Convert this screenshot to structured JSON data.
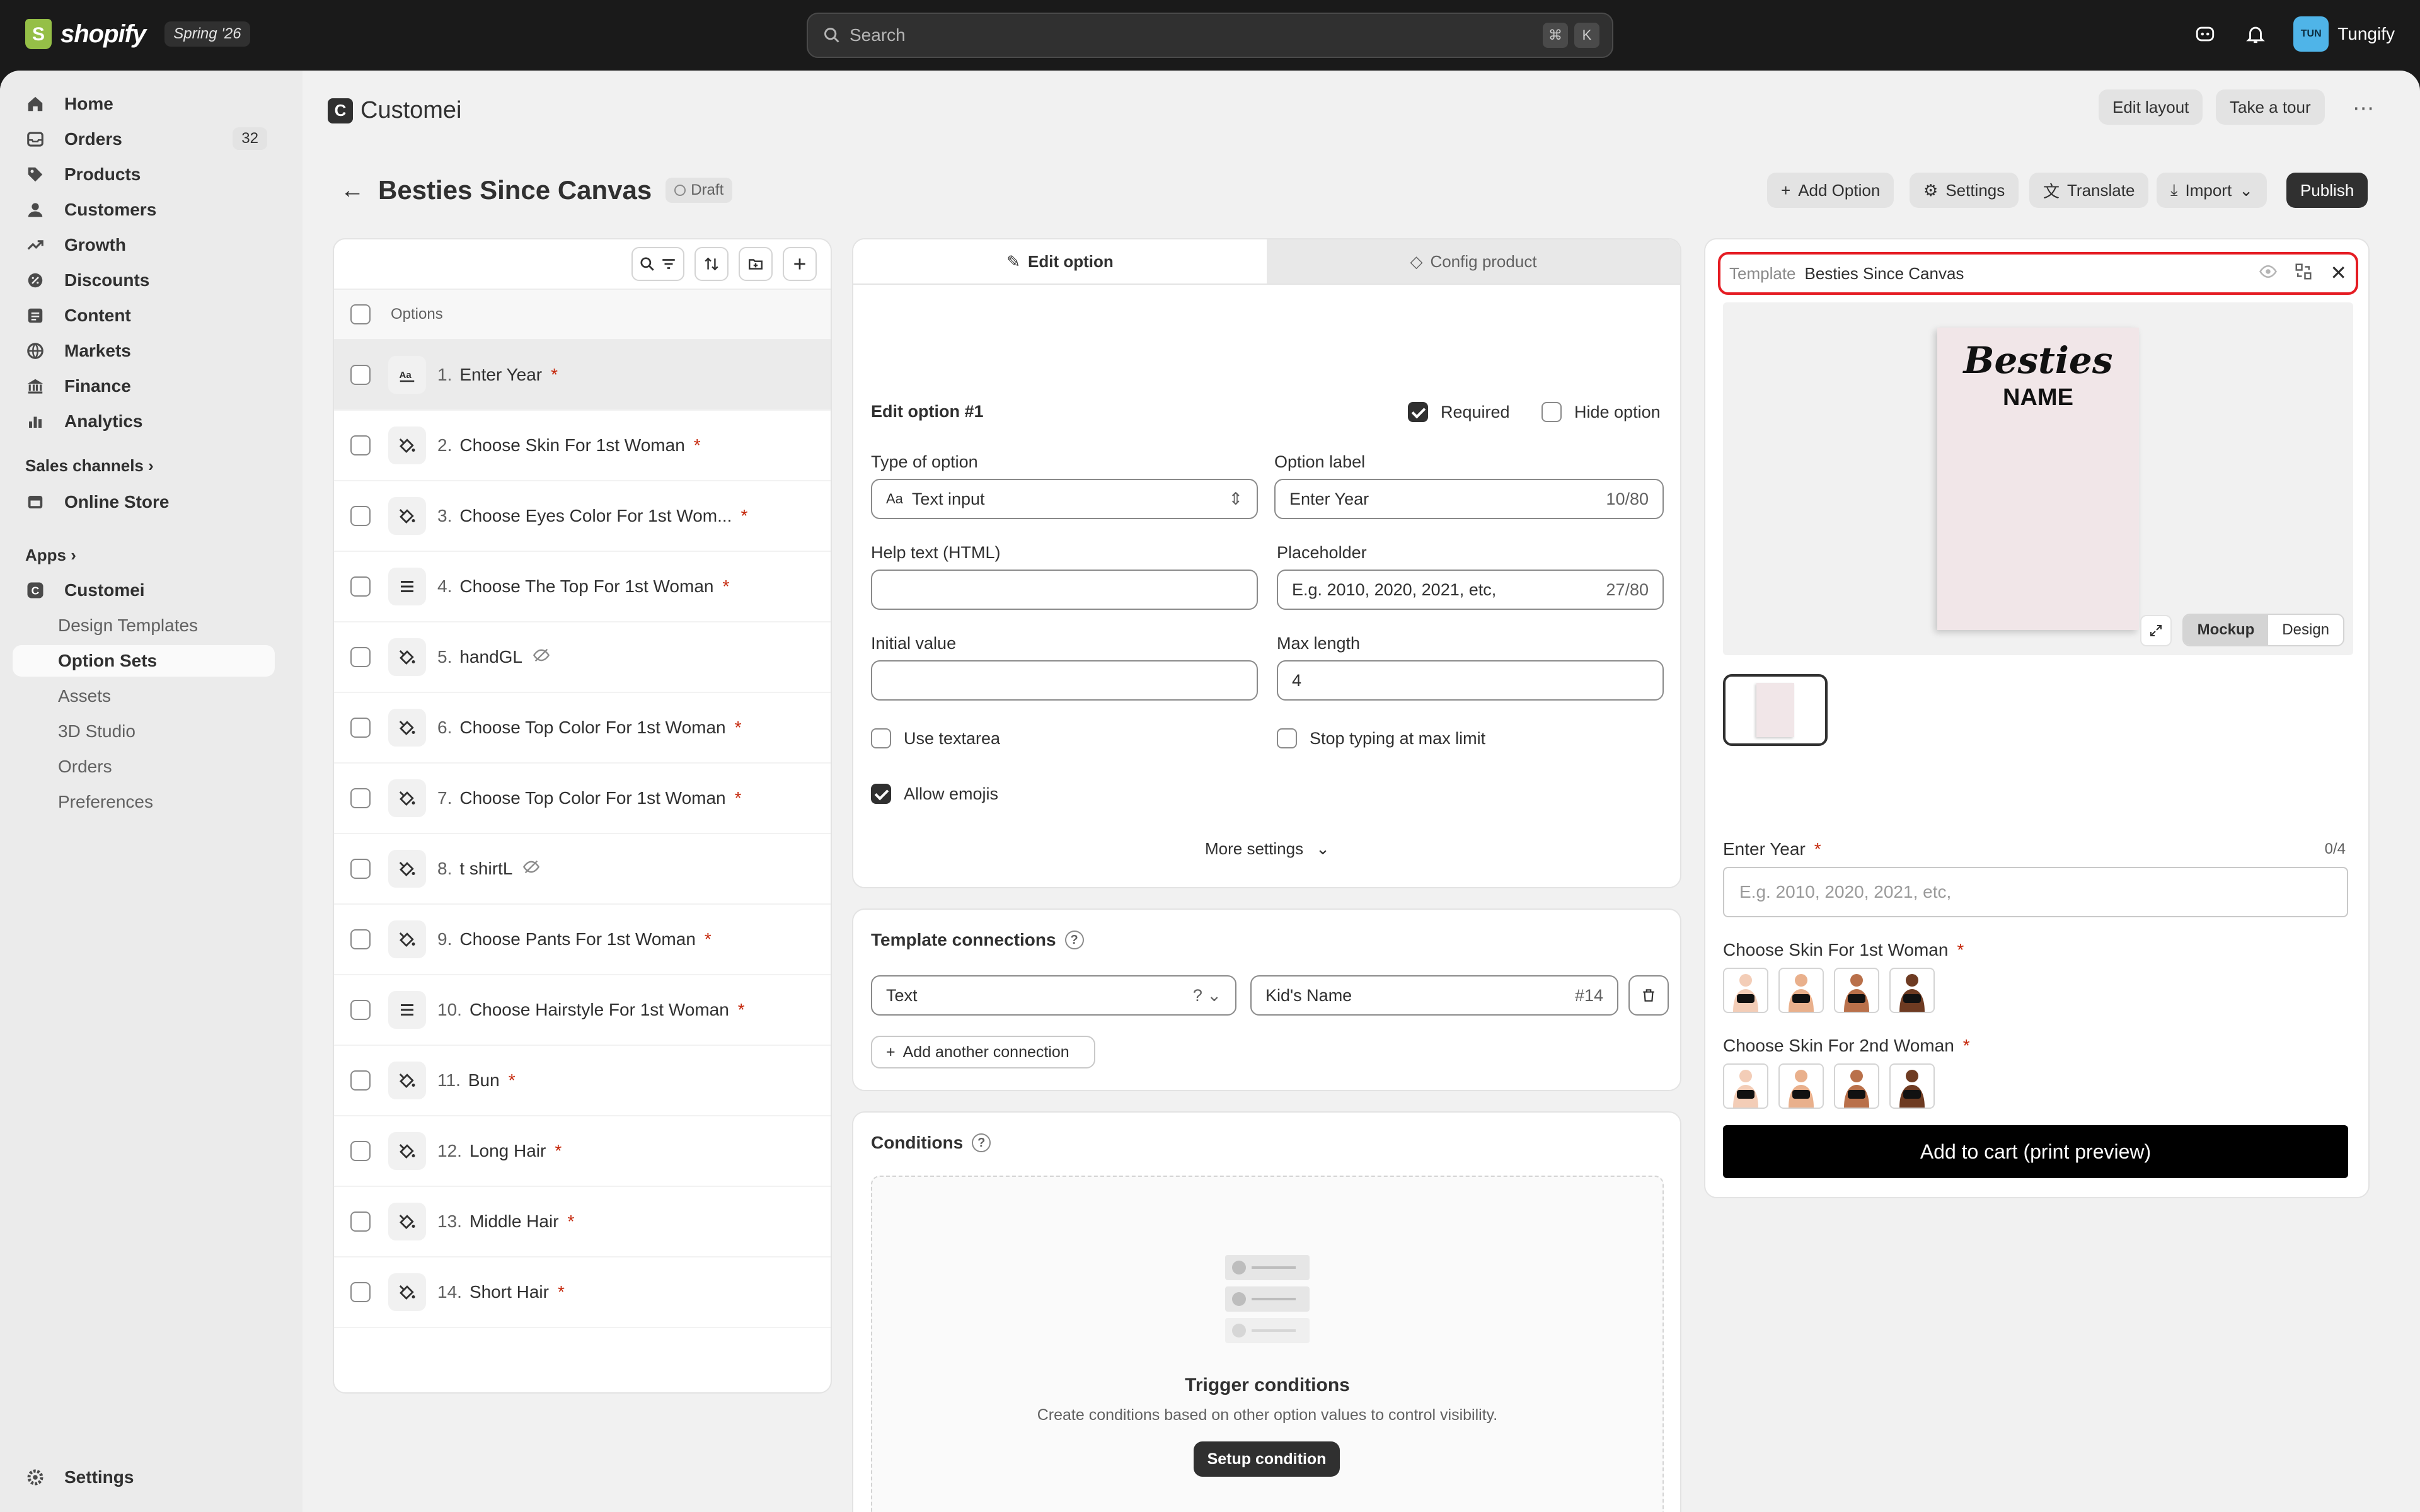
{
  "topbar": {
    "brand": "shopify",
    "edition": "Spring '26",
    "search_placeholder": "Search",
    "shortcut_keys": [
      "⌘",
      "K"
    ],
    "avatar_initials": "TUN",
    "store_name": "Tungify"
  },
  "sidebar": {
    "items": [
      {
        "label": "Home",
        "icon": "home-icon"
      },
      {
        "label": "Orders",
        "icon": "orders-icon",
        "badge": "32"
      },
      {
        "label": "Products",
        "icon": "tag-icon"
      },
      {
        "label": "Customers",
        "icon": "person-icon"
      },
      {
        "label": "Growth",
        "icon": "growth-icon"
      },
      {
        "label": "Discounts",
        "icon": "discount-icon"
      },
      {
        "label": "Content",
        "icon": "content-icon"
      },
      {
        "label": "Markets",
        "icon": "globe-icon"
      },
      {
        "label": "Finance",
        "icon": "bank-icon"
      },
      {
        "label": "Analytics",
        "icon": "chart-icon"
      }
    ],
    "sales_channels_label": "Sales channels",
    "online_store": "Online Store",
    "apps_label": "Apps",
    "app_name": "Customei",
    "app_subitems": [
      "Design Templates",
      "Option Sets",
      "Assets",
      "3D Studio",
      "Orders",
      "Preferences"
    ],
    "active_subitem": "Option Sets",
    "settings": "Settings"
  },
  "header": {
    "app_title": "Customei",
    "app_logo_letter": "C",
    "edit_layout": "Edit layout",
    "take_tour": "Take a tour"
  },
  "page": {
    "title": "Besties Since Canvas",
    "status": "Draft",
    "actions": {
      "add_option": "Add Option",
      "settings": "Settings",
      "translate": "Translate",
      "import": "Import",
      "publish": "Publish"
    }
  },
  "options_list": {
    "header": "Options",
    "rows": [
      {
        "num": "1.",
        "label": "Enter Year",
        "required": true,
        "hidden": false,
        "icon": "text-icon"
      },
      {
        "num": "2.",
        "label": "Choose Skin For 1st Woman",
        "required": true,
        "hidden": false,
        "icon": "paint-icon"
      },
      {
        "num": "3.",
        "label": "Choose Eyes Color For 1st Wom...",
        "required": true,
        "hidden": false,
        "icon": "paint-icon"
      },
      {
        "num": "4.",
        "label": "Choose The Top For 1st Woman",
        "required": true,
        "hidden": false,
        "icon": "list-icon"
      },
      {
        "num": "5.",
        "label": "handGL",
        "required": false,
        "hidden": true,
        "icon": "paint-icon"
      },
      {
        "num": "6.",
        "label": "Choose Top Color For 1st Woman",
        "required": true,
        "hidden": false,
        "icon": "paint-icon"
      },
      {
        "num": "7.",
        "label": "Choose Top Color For 1st Woman",
        "required": true,
        "hidden": false,
        "icon": "paint-icon"
      },
      {
        "num": "8.",
        "label": "t shirtL",
        "required": false,
        "hidden": true,
        "icon": "paint-icon"
      },
      {
        "num": "9.",
        "label": "Choose Pants For 1st Woman",
        "required": true,
        "hidden": false,
        "icon": "paint-icon"
      },
      {
        "num": "10.",
        "label": "Choose Hairstyle For 1st Woman",
        "required": true,
        "hidden": false,
        "icon": "list-icon"
      },
      {
        "num": "11.",
        "label": "Bun",
        "required": true,
        "hidden": false,
        "icon": "paint-icon"
      },
      {
        "num": "12.",
        "label": "Long Hair",
        "required": true,
        "hidden": false,
        "icon": "paint-icon"
      },
      {
        "num": "13.",
        "label": "Middle Hair",
        "required": true,
        "hidden": false,
        "icon": "paint-icon"
      },
      {
        "num": "14.",
        "label": "Short Hair",
        "required": true,
        "hidden": false,
        "icon": "paint-icon"
      }
    ]
  },
  "editor": {
    "tab_edit": "Edit option",
    "tab_config": "Config product",
    "heading": "Edit option #1",
    "required_label": "Required",
    "hide_label": "Hide option",
    "type_label": "Type of option",
    "type_value": "Text input",
    "option_label_label": "Option label",
    "option_label_value": "Enter Year",
    "option_label_count": "10/80",
    "help_label": "Help text (HTML)",
    "placeholder_label": "Placeholder",
    "placeholder_value": "E.g. 2010, 2020, 2021, etc,",
    "placeholder_count": "27/80",
    "initial_label": "Initial value",
    "maxlen_label": "Max length",
    "maxlen_value": "4",
    "use_textarea": "Use textarea",
    "stop_typing": "Stop typing at max limit",
    "allow_emojis": "Allow emojis",
    "more_settings": "More settings"
  },
  "connections": {
    "title": "Template connections",
    "type_value": "Text",
    "layer_value": "Kid's Name",
    "layer_id": "#14",
    "add_another": "Add another connection"
  },
  "conditions": {
    "title": "Conditions",
    "empty_title": "Trigger conditions",
    "empty_desc": "Create conditions based on other option values to control visibility.",
    "setup": "Setup condition"
  },
  "preview": {
    "template_label": "Template",
    "template_name": "Besties Since Canvas",
    "print_title": "Besties",
    "print_subtitle": "NAME",
    "mode_mockup": "Mockup",
    "mode_design": "Design",
    "field1_label": "Enter Year",
    "field1_count": "0/4",
    "field1_placeholder": "E.g. 2010, 2020, 2021, etc,",
    "field2_label": "Choose Skin For 1st Woman",
    "field3_label": "Choose Skin For 2nd Woman",
    "skin_tones": [
      "#f3cdb7",
      "#e9b08c",
      "#b9704a",
      "#6e3b22"
    ],
    "cart_button": "Add to cart (print preview)"
  }
}
